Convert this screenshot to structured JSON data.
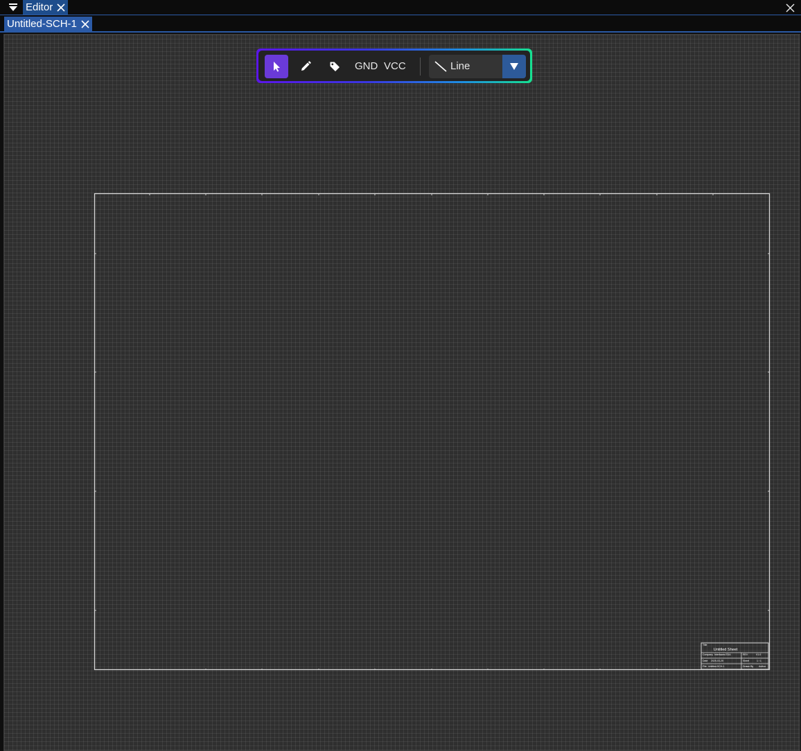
{
  "window": {
    "title": "Editor"
  },
  "tabs": [
    {
      "label": "Untitled-SCH-1",
      "active": true
    }
  ],
  "toolbar": {
    "tools": [
      {
        "name": "select",
        "icon": "pointer-icon",
        "active": true
      },
      {
        "name": "draw",
        "icon": "pencil-icon",
        "active": false
      },
      {
        "name": "label",
        "icon": "tag-icon",
        "active": false
      }
    ],
    "gnd_label": "GND",
    "vcc_label": "VCC",
    "shape_select": {
      "value": "Line",
      "icon": "line-icon"
    }
  },
  "sheet": {
    "title_block": {
      "title_caption": "Title",
      "title": "Untitled Sheet",
      "company_caption": "Company",
      "company": "Interfaces EDA",
      "rev_caption": "REV",
      "rev": "V1.0",
      "date_caption": "Date",
      "date": "2025-03-25",
      "sheet_caption": "Sheet",
      "sheet": "1 / 1",
      "file_caption": "File",
      "file": "Untitled-SCH-1",
      "drawn_caption": "Drawn By",
      "drawn": "Author"
    }
  },
  "colors": {
    "accent": "#2b5aa6",
    "active_tool": "#6a3ad8",
    "canvas": "#2f2f2f",
    "sheet_border": "#d8d8d8"
  }
}
